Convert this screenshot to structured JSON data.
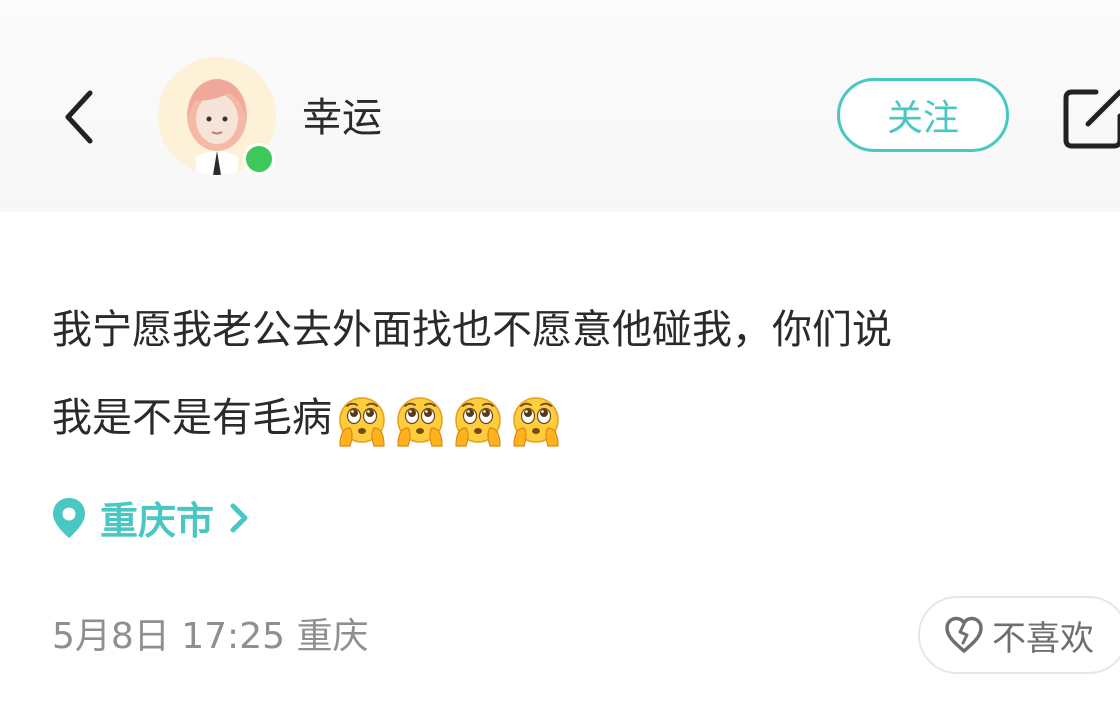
{
  "header": {
    "username": "幸运",
    "follow_label": "关注",
    "online": true
  },
  "post": {
    "line1": "我宁愿我老公去外面找也不愿意他碰我，你们说",
    "line2": "我是不是有毛病",
    "emoji_count": 4,
    "emoji_name": "pleading-face"
  },
  "location": {
    "label": "重庆市"
  },
  "meta": {
    "timestamp": "5月8日 17:25 重庆",
    "dislike_label": "不喜欢"
  },
  "colors": {
    "accent": "#49c7c3",
    "online": "#3cc95a",
    "text": "#2a2a2a",
    "muted": "#8f8f8f"
  },
  "icons": [
    "chevron-left-icon",
    "share-icon",
    "location-pin-icon",
    "chevron-right-icon",
    "broken-heart-icon"
  ]
}
